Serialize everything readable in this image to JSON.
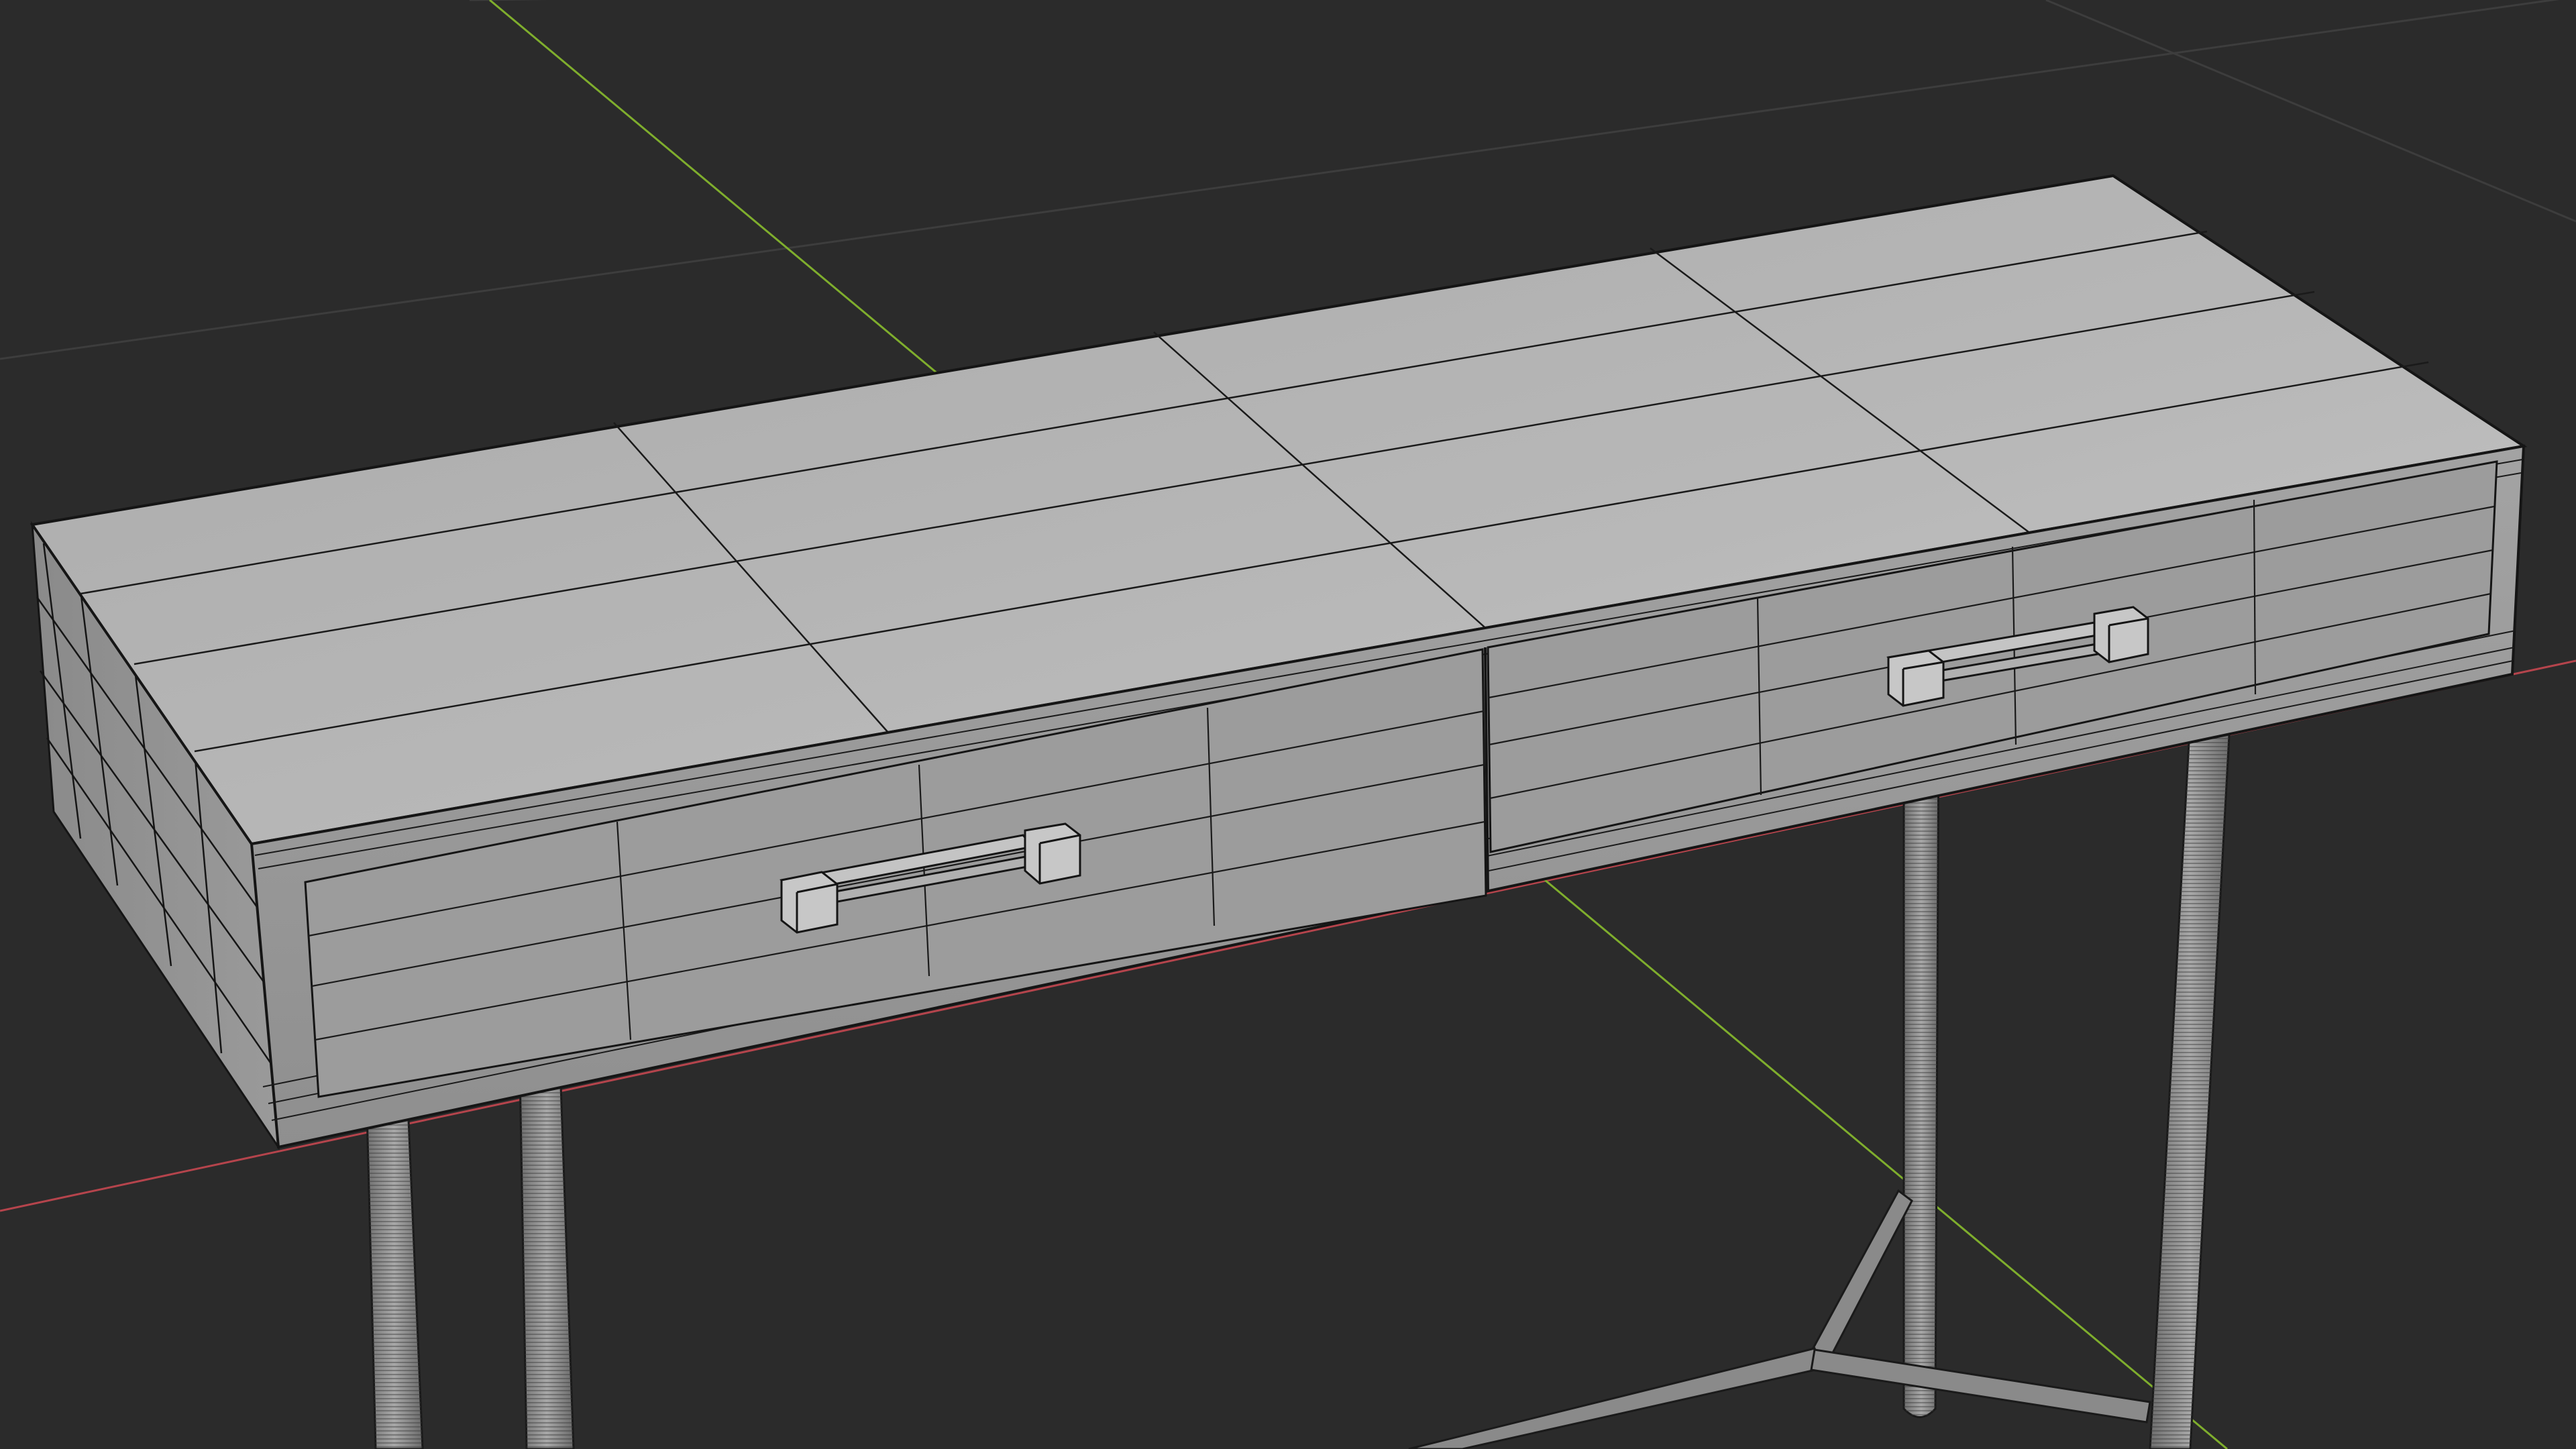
{
  "viewport": {
    "background_color": "#2b2b2b",
    "grid_color": "#3a3a3a",
    "x_axis_color": "#b5444c",
    "y_axis_color": "#7fae2d",
    "view": "perspective",
    "shading": "solid",
    "overlay": "wireframe"
  },
  "scene": {
    "model": "console-table",
    "drawer_count": 2,
    "leg_count": 4,
    "surface_color": "#b9b9b9",
    "edge_color": "#151515",
    "leg_color": "#8c8c8c"
  }
}
